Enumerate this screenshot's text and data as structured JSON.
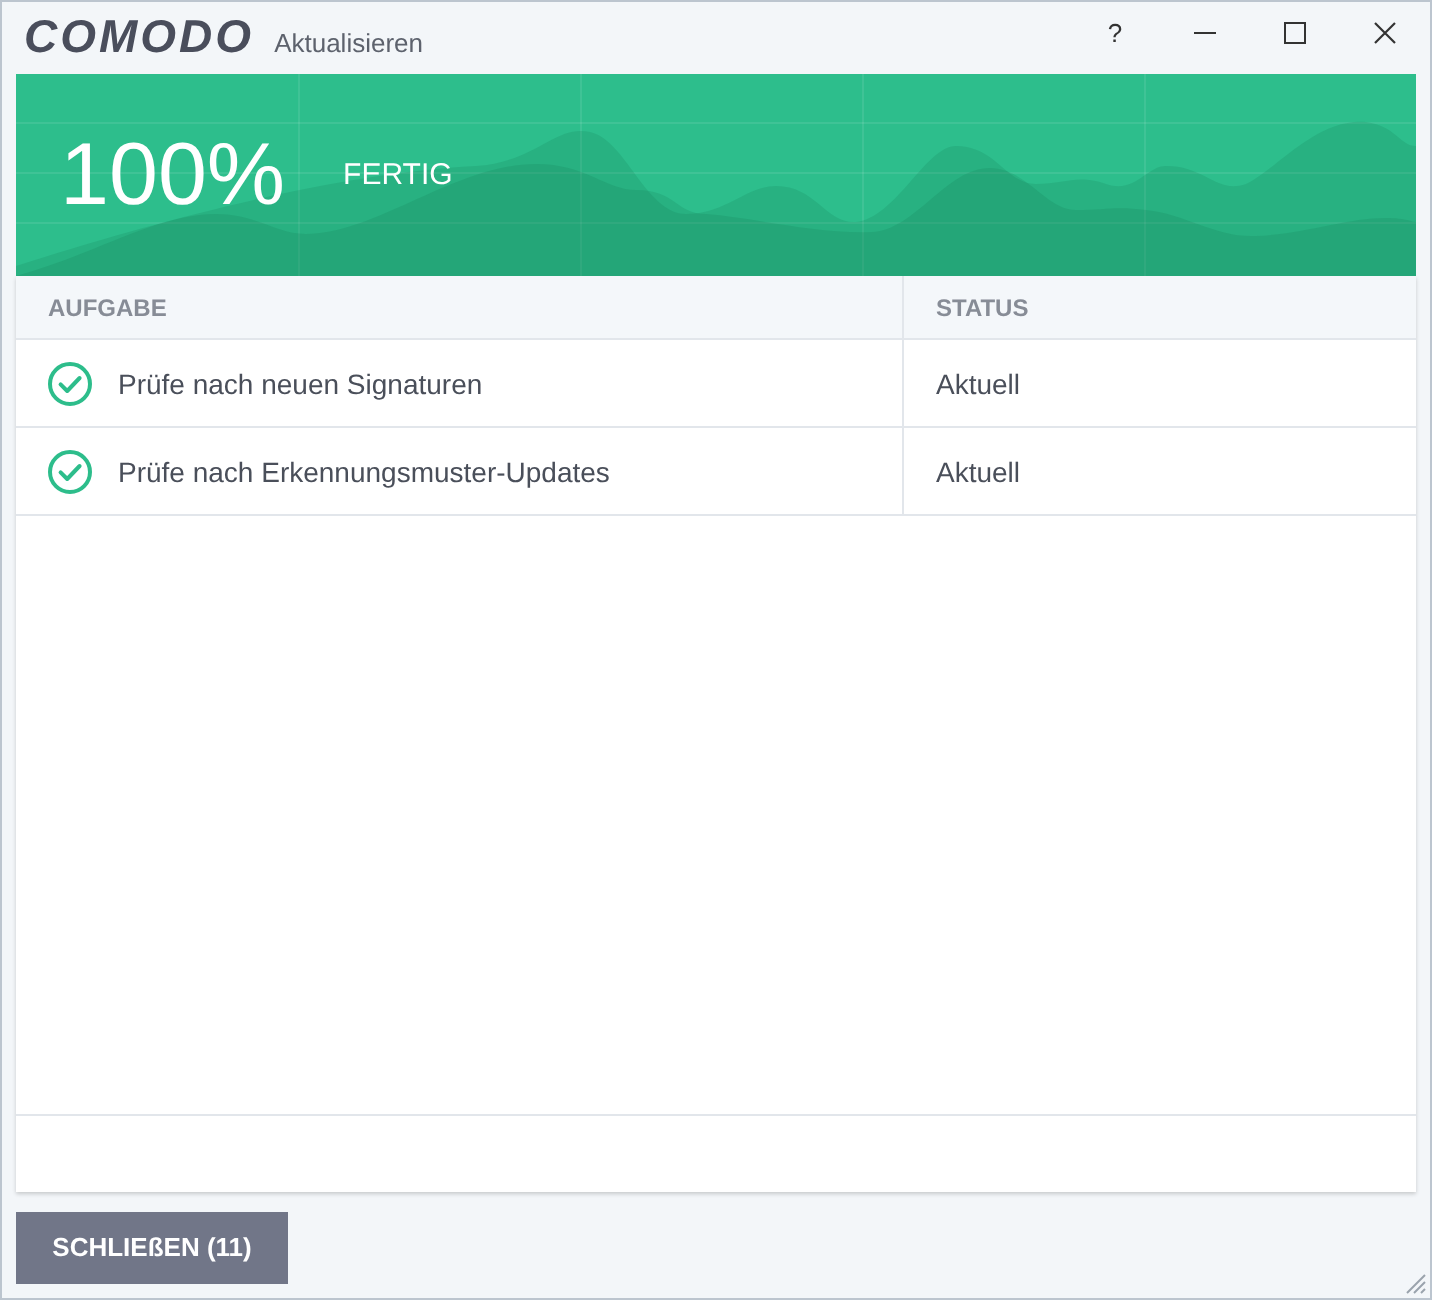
{
  "window": {
    "logo": "COMODO",
    "title": "Aktualisieren",
    "help_button": "?"
  },
  "banner": {
    "percent": "100%",
    "status": "FERTIG"
  },
  "table": {
    "columns": [
      "AUFGABE",
      "STATUS"
    ],
    "rows": [
      {
        "task": "Prüfe nach neuen Signaturen",
        "status": "Aktuell",
        "done": true
      },
      {
        "task": "Prüfe nach Erkennungsmuster-Updates",
        "status": "Aktuell",
        "done": true
      }
    ]
  },
  "close_button": "SCHLIEßEN (11)"
}
